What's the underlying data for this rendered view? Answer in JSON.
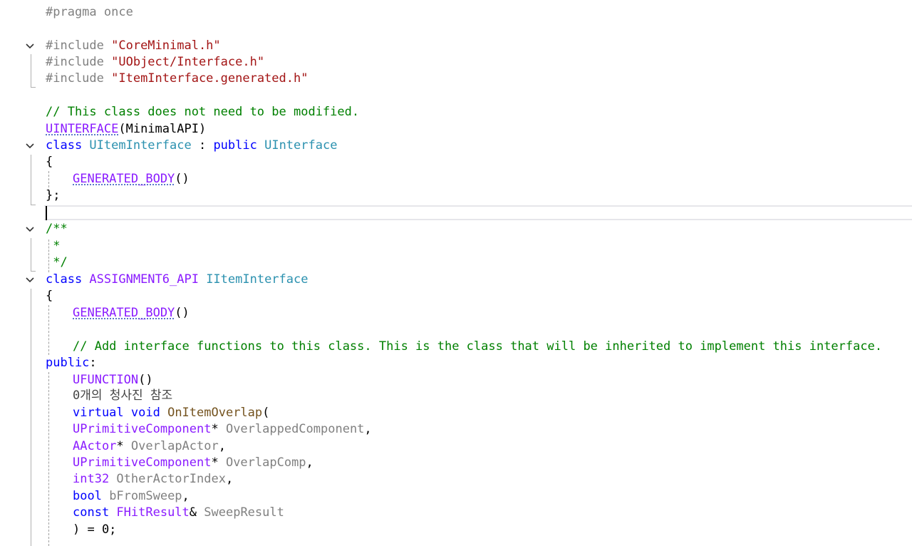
{
  "editor": {
    "lines": {
      "l1": {
        "a": "#pragma once"
      },
      "l3": {
        "a": "#include ",
        "b": "\"CoreMinimal.h\""
      },
      "l4": {
        "a": "#include ",
        "b": "\"UObject/Interface.h\""
      },
      "l5": {
        "a": "#include ",
        "b": "\"ItemInterface.generated.h\""
      },
      "l7": {
        "a": "// This class does not need to be modified."
      },
      "l8": {
        "a": "UINTERFACE",
        "b": "(MinimalAPI)"
      },
      "l9": {
        "a": "class",
        "b": " UItemInterface ",
        "c": ":",
        "d": " public",
        "e": " UInterface"
      },
      "l10": {
        "a": "{"
      },
      "l11": {
        "a": "GENERATED_BODY",
        "b": "()"
      },
      "l12": {
        "a": "};"
      },
      "l14": {
        "a": "/**"
      },
      "l15": {
        "a": " *"
      },
      "l16": {
        "a": " */"
      },
      "l17": {
        "a": "class",
        "b": " ASSIGNMENT6_API",
        "c": " IItemInterface"
      },
      "l18": {
        "a": "{"
      },
      "l19": {
        "a": "GENERATED_BODY",
        "b": "()"
      },
      "l21": {
        "a": "// Add interface functions to this class. This is the class that will be inherited to implement this interface."
      },
      "l22": {
        "a": "public",
        "b": ":"
      },
      "l23": {
        "a": "UFUNCTION",
        "b": "()"
      },
      "l24": {
        "a": "0개의 청사진 참조"
      },
      "l25": {
        "a": "virtual",
        "b": " void",
        "c": " OnItemOverlap",
        "d": "("
      },
      "l26": {
        "a": "UPrimitiveComponent",
        "b": "* ",
        "c": "OverlappedComponent",
        "d": ","
      },
      "l27": {
        "a": "AActor",
        "b": "* ",
        "c": "OverlapActor",
        "d": ","
      },
      "l28": {
        "a": "UPrimitiveComponent",
        "b": "* ",
        "c": "OverlapComp",
        "d": ","
      },
      "l29": {
        "a": "int32",
        "b": " OtherActorIndex",
        "c": ","
      },
      "l30": {
        "a": "bool",
        "b": " bFromSweep",
        "c": ","
      },
      "l31": {
        "a": "const",
        "b": " FHitResult",
        "c": "& ",
        "d": "SweepResult"
      },
      "l32": {
        "a": ") = 0;"
      }
    },
    "icons": {
      "fold": "chevron-down-icon"
    }
  }
}
